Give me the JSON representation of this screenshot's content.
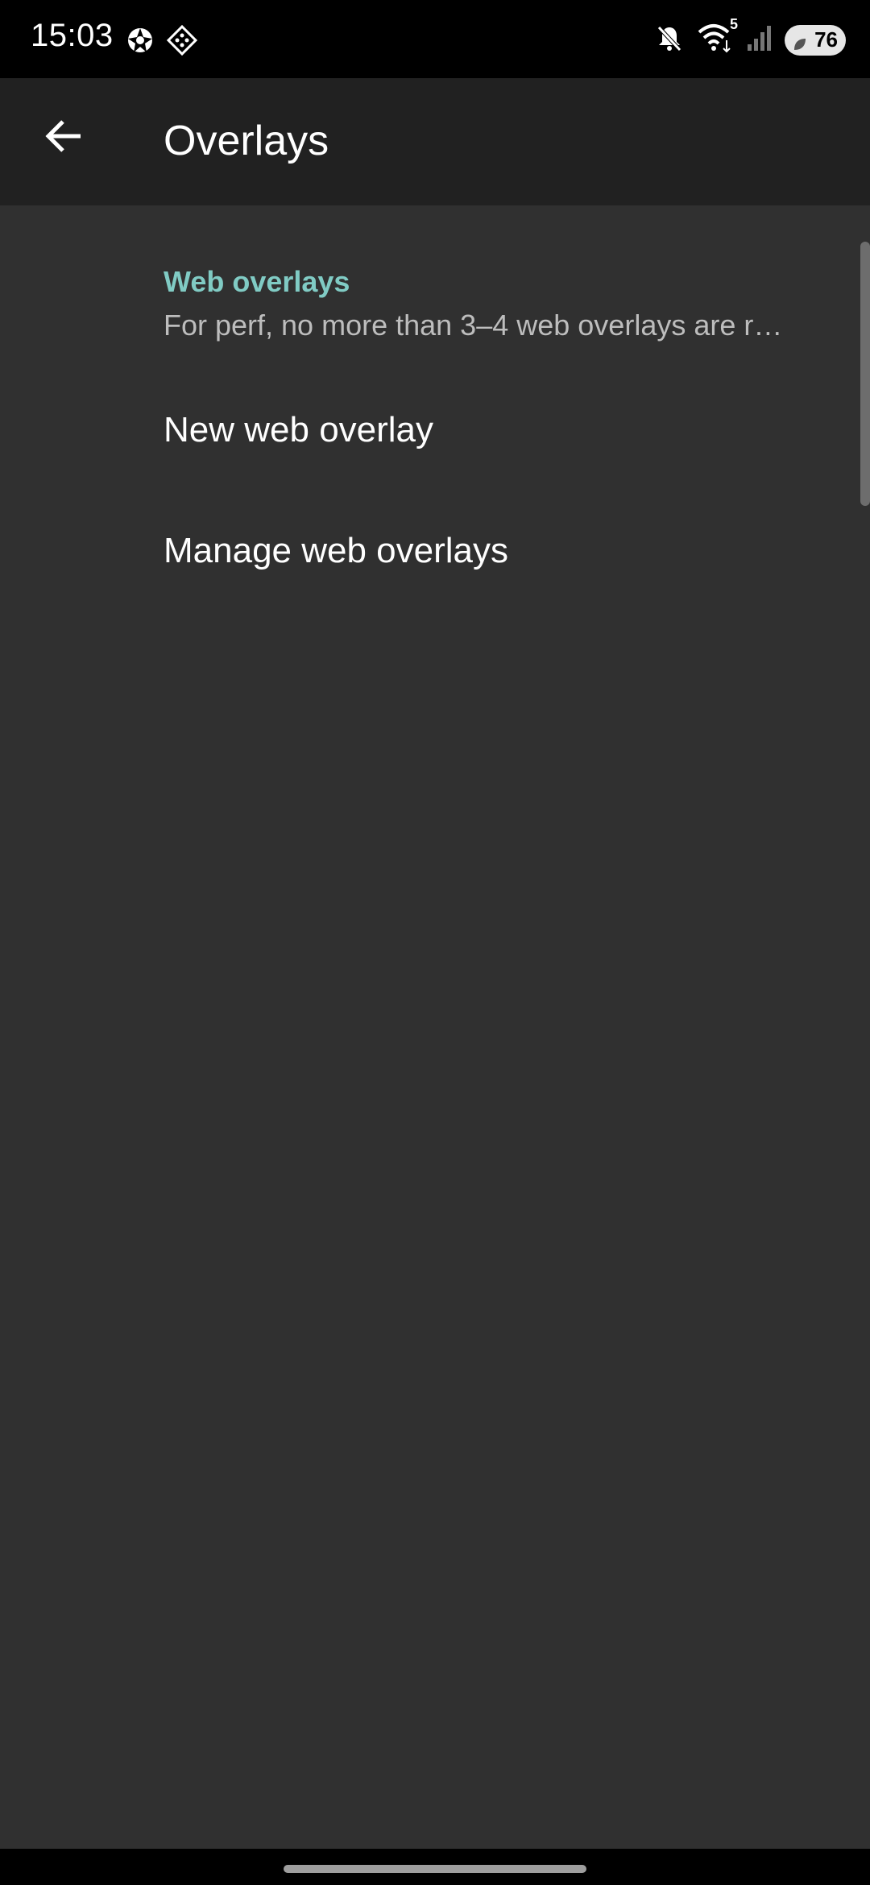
{
  "status_bar": {
    "time": "15:03",
    "battery_level": "76",
    "wifi_badge": "5",
    "icons": [
      "aperture-icon",
      "diamond-grid-icon",
      "mute-icon",
      "wifi-icon",
      "signal-icon",
      "battery-icon"
    ]
  },
  "app_bar": {
    "title": "Overlays",
    "back_icon": "arrow-back-icon"
  },
  "web_overlays_section": {
    "title": "Web overlays",
    "summary": "For perf, no more than 3–4 web overlays are r…"
  },
  "preferences": [
    {
      "label": "New web overlay"
    },
    {
      "label": "Manage web overlays"
    }
  ],
  "colors": {
    "accent": "#80cbc4",
    "background": "#303030",
    "app_bar": "#212121",
    "status_bar": "#000000"
  }
}
